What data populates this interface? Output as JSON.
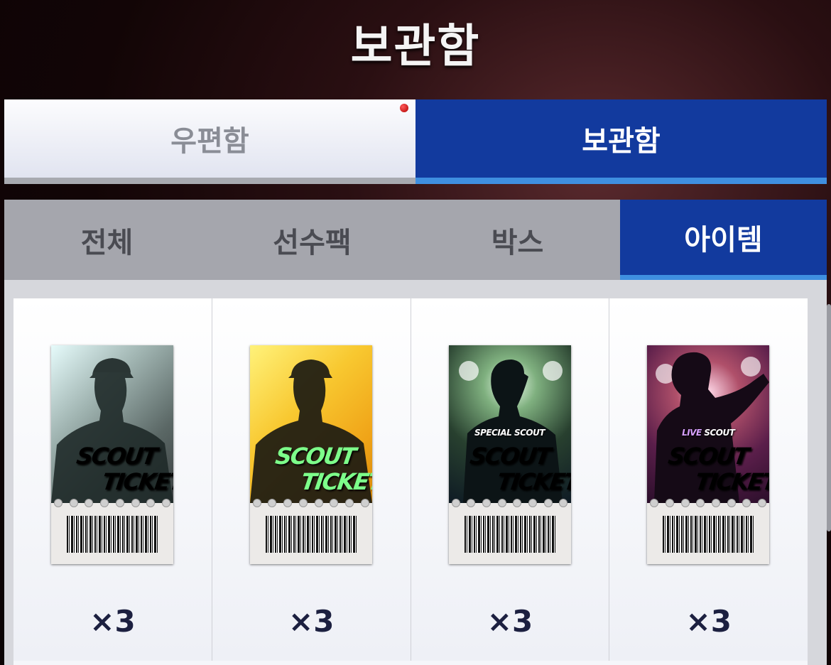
{
  "page_title": "보관함",
  "main_tabs": [
    {
      "label": "우편함",
      "active": false,
      "notification": true
    },
    {
      "label": "보관함",
      "active": true,
      "notification": false
    }
  ],
  "sub_tabs": [
    {
      "label": "전체",
      "active": false
    },
    {
      "label": "선수팩",
      "active": false
    },
    {
      "label": "박스",
      "active": false
    },
    {
      "label": "아이템",
      "active": true
    }
  ],
  "items": [
    {
      "line1": "SCOUT",
      "line2": "TICKET",
      "tag": "",
      "quantity": "×3",
      "style": "gray",
      "word_color": "#ffffff"
    },
    {
      "line1": "SCOUT",
      "line2": "TICKET",
      "tag": "",
      "quantity": "×3",
      "style": "gold",
      "word_color": "#7dff8a"
    },
    {
      "line1": "SCOUT",
      "line2": "TICKET",
      "tag": "SPECIAL SCOUT",
      "quantity": "×3",
      "style": "special",
      "word_color": "#ffffff"
    },
    {
      "line1": "SCOUT",
      "line2": "TICKET",
      "tag_prefix": "LIVE",
      "tag": " SCOUT",
      "quantity": "×3",
      "style": "live",
      "word_color": "#ffffff"
    }
  ],
  "colors": {
    "accent_blue": "#123a9e",
    "active_underline": "#3f8fe0",
    "notification_red": "#d01010"
  }
}
